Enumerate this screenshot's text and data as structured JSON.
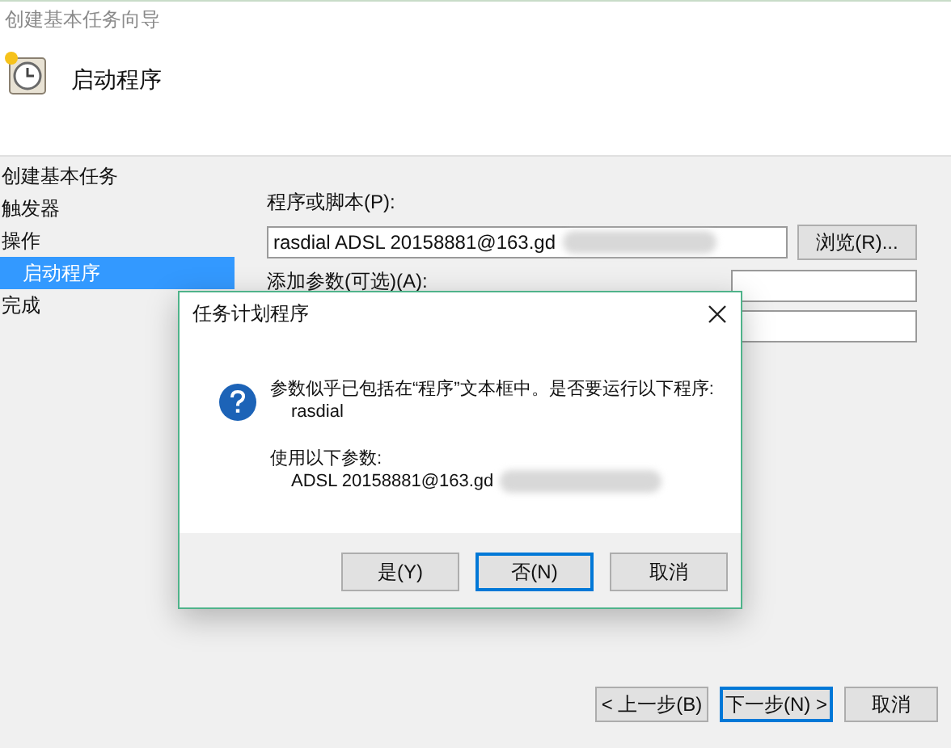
{
  "window": {
    "title": "创建基本任务向导"
  },
  "header": {
    "title": "启动程序"
  },
  "steps": [
    {
      "label": "创建基本任务",
      "selected": false
    },
    {
      "label": "触发器",
      "selected": false
    },
    {
      "label": "操作",
      "selected": false,
      "children": [
        {
          "label": "启动程序",
          "selected": true
        }
      ]
    },
    {
      "label": "完成",
      "selected": false
    }
  ],
  "form": {
    "program_label": "程序或脚本(P):",
    "program_value": "rasdial ADSL 20158881@163.gd",
    "program_redacted": true,
    "browse_button": "浏览(R)...",
    "args_label": "添加参数(可选)(A):"
  },
  "dialog": {
    "title": "任务计划程序",
    "message": "参数似乎已包括在“程序”文本框中。是否要运行以下程序:",
    "program": "rasdial",
    "args_label": "使用以下参数:",
    "args": "ADSL 20158881@163.gd",
    "args_redacted": true,
    "buttons": [
      {
        "label": "是(Y)",
        "focused": false
      },
      {
        "label": "否(N)",
        "focused": true
      },
      {
        "label": "取消",
        "focused": false
      }
    ]
  },
  "buttons": [
    {
      "label": "< 上一步(B)",
      "focused": false
    },
    {
      "label": "下一步(N) >",
      "focused": true
    },
    {
      "label": "取消",
      "focused": false
    }
  ]
}
